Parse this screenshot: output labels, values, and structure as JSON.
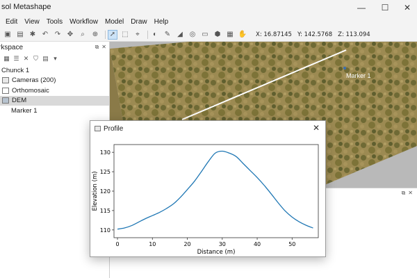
{
  "window": {
    "title": "sol Metashape",
    "minimize": "—",
    "maximize": "☐",
    "close": "✕"
  },
  "menu": [
    "Edit",
    "View",
    "Tools",
    "Workflow",
    "Model",
    "Draw",
    "Help"
  ],
  "toolbar": {
    "coords": {
      "x": "X:  16.87145",
      "y": "Y:  142.5768",
      "z": "Z:  113.094"
    }
  },
  "workspace": {
    "label": "rkspace",
    "chunk": "Chunck 1",
    "items": [
      {
        "label": "Cameras (200)",
        "icon": "camera-icon"
      },
      {
        "label": "Orthomosaic",
        "icon": "orthomosaic-icon"
      },
      {
        "label": "DEM",
        "icon": "dem-icon",
        "selected": true
      },
      {
        "label": "Marker 1",
        "icon": ""
      }
    ]
  },
  "viewport": {
    "marker_label": "Marker 1"
  },
  "profile": {
    "title": "Profile",
    "close": "✕"
  },
  "chart_data": {
    "type": "line",
    "xlabel": "Distance (m)",
    "ylabel": "Elevation (m)",
    "xlim": [
      -1,
      57.5
    ],
    "ylim": [
      108,
      132
    ],
    "xticks": [
      0,
      10,
      20,
      30,
      40,
      50
    ],
    "yticks": [
      110,
      115,
      120,
      125,
      130
    ],
    "grid": false,
    "color": "#1f77b4",
    "x": [
      0,
      2,
      4,
      6,
      8,
      10,
      12,
      14,
      16,
      18,
      20,
      22,
      24,
      26,
      28,
      30,
      32,
      34,
      36,
      38,
      40,
      42,
      44,
      46,
      48,
      50,
      52,
      54,
      56
    ],
    "y": [
      110.2,
      110.5,
      111.1,
      112.0,
      112.9,
      113.7,
      114.5,
      115.5,
      116.7,
      118.4,
      120.4,
      122.5,
      125.0,
      127.6,
      129.8,
      130.3,
      129.8,
      128.9,
      127.1,
      125.3,
      123.5,
      121.5,
      119.3,
      117.0,
      114.9,
      113.3,
      112.1,
      111.2,
      110.5
    ]
  }
}
